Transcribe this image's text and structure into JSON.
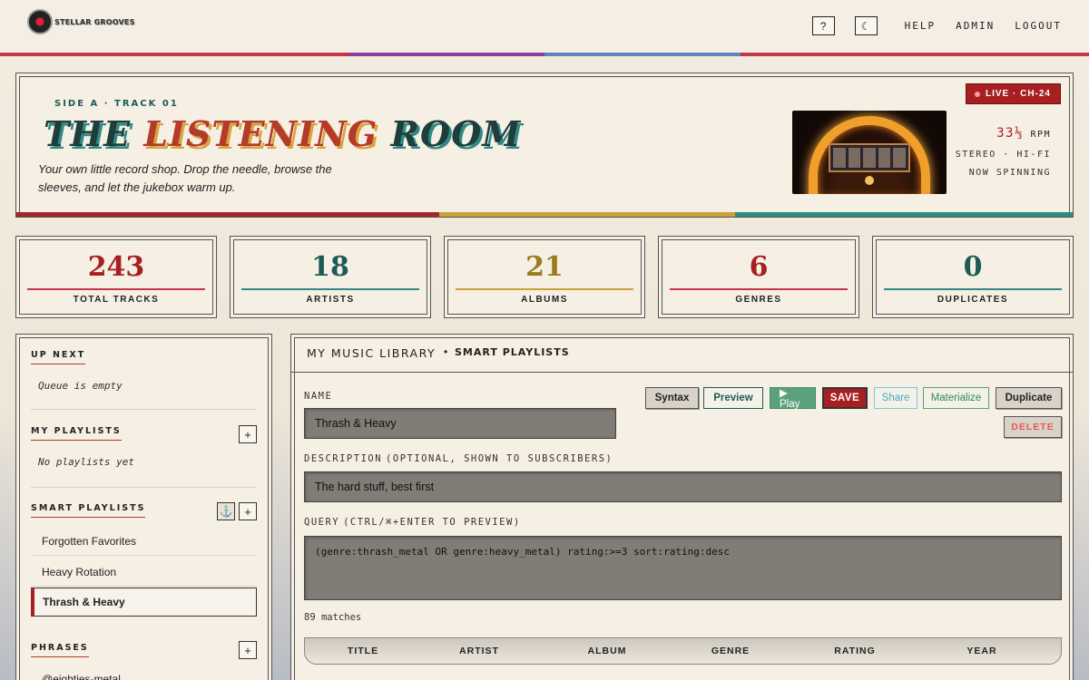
{
  "brand": {
    "name": "STELLAR GROOVES"
  },
  "nav": {
    "help_icon": "?",
    "theme_icon": "moon-icon",
    "links": [
      "HELP",
      "ADMIN",
      "LOGOUT"
    ]
  },
  "hero": {
    "side_label": "SIDE A · TRACK 01",
    "title_part1": "THE ",
    "title_part2": "LISTENING",
    "title_part3": " ROOM",
    "subtitle": "Your own little record shop. Drop the needle, browse the sleeves, and let the jukebox warm up.",
    "live_badge": "LIVE · CH-24",
    "rpm_value": "33⅓",
    "rpm_unit": "RPM",
    "spec_line1": "STEREO · HI-FI",
    "spec_line2": "NOW SPINNING"
  },
  "stats": [
    {
      "value": "243",
      "label": "TOTAL TRACKS",
      "color": "#a81f22",
      "line": "#c8354a"
    },
    {
      "value": "18",
      "label": "ARTISTS",
      "color": "#1e5b57",
      "line": "#2f8a86"
    },
    {
      "value": "21",
      "label": "ALBUMS",
      "color": "#9a7a1a",
      "line": "#c9a23a"
    },
    {
      "value": "6",
      "label": "GENRES",
      "color": "#a81f22",
      "line": "#c8354a"
    },
    {
      "value": "0",
      "label": "DUPLICATES",
      "color": "#1e5b57",
      "line": "#2f8a86"
    }
  ],
  "sidebar": {
    "up_next": {
      "heading": "UP NEXT",
      "empty": "Queue is empty"
    },
    "my_playlists": {
      "heading": "MY PLAYLISTS",
      "empty": "No playlists yet",
      "add": "+"
    },
    "smart_playlists": {
      "heading": "SMART PLAYLISTS",
      "anchor": "⚓",
      "add": "+",
      "items": [
        "Forgotten Favorites",
        "Heavy Rotation",
        "Thrash & Heavy"
      ]
    },
    "phrases": {
      "heading": "PHRASES",
      "add": "+",
      "items": [
        "@eighties-metal"
      ]
    }
  },
  "editor": {
    "tab_library": "MY MUSIC LIBRARY",
    "tab_separator": "•",
    "tab_smart": "SMART PLAYLISTS",
    "name_label": "NAME",
    "name_value": "Thrash & Heavy",
    "desc_label": "DESCRIPTION",
    "desc_hint": "(OPTIONAL, SHOWN TO SUBSCRIBERS)",
    "desc_value": "The hard stuff, best first",
    "query_label": "QUERY",
    "query_hint": "(CTRL/⌘+ENTER TO PREVIEW)",
    "query_value": "(genre:thrash_metal OR genre:heavy_metal) rating:>=3 sort:rating:desc",
    "buttons": {
      "syntax": "Syntax",
      "preview": "Preview",
      "play": "▶ Play",
      "save": "SAVE",
      "share": "Share",
      "materialize": "Materialize",
      "duplicate": "Duplicate",
      "delete": "DELETE"
    },
    "matches": "89 matches",
    "columns": [
      "TITLE",
      "ARTIST",
      "ALBUM",
      "GENRE",
      "RATING",
      "YEAR"
    ]
  }
}
